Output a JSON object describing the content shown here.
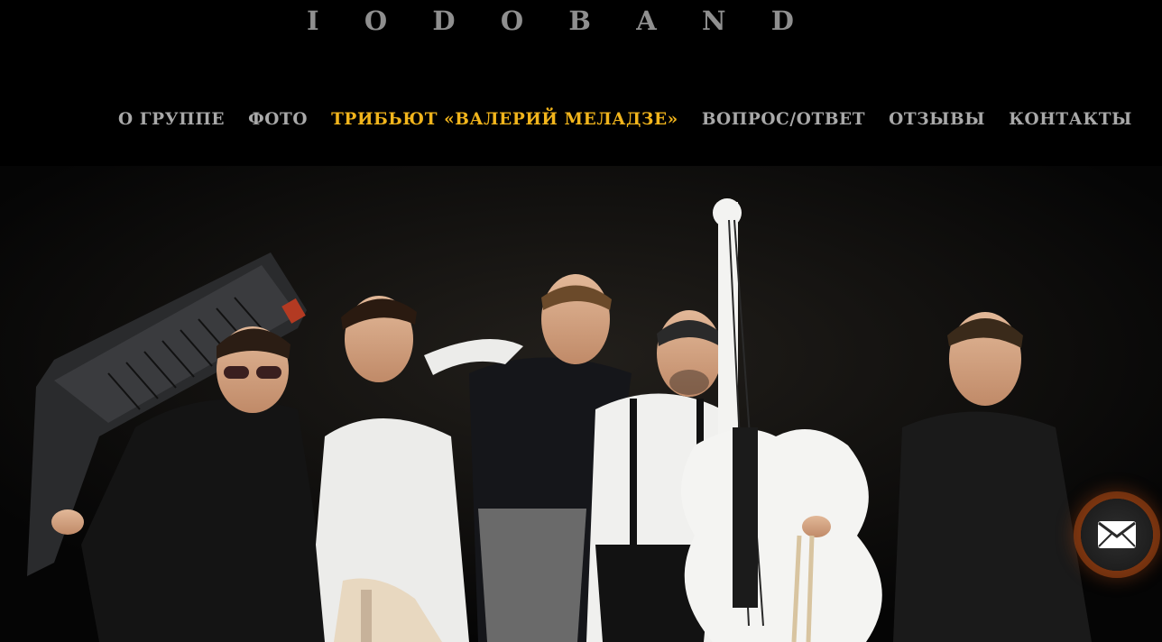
{
  "brand": {
    "letters": [
      "I",
      "O",
      "D",
      "O",
      "B",
      "A",
      "N",
      "D"
    ]
  },
  "nav": {
    "items": [
      {
        "label": "О ГРУППЕ",
        "active": false
      },
      {
        "label": "ФОТО",
        "active": false
      },
      {
        "label": "ТРИБЬЮТ «ВАЛЕРИЙ МЕЛАДЗЕ»",
        "active": true
      },
      {
        "label": "ВОПРОС/ОТВЕТ",
        "active": false
      },
      {
        "label": "ОТЗЫВЫ",
        "active": false
      },
      {
        "label": "КОНТАКТЫ",
        "active": false
      }
    ]
  },
  "hero": {
    "description": "Band photo: five musicians in black and white shirts with keytar, electric guitar and white double bass against a black backdrop"
  },
  "chat_widget": {
    "icon": "envelope-icon"
  },
  "colors": {
    "background": "#000000",
    "nav_text": "#a9a9a9",
    "nav_active": "#f2b51c",
    "logo": "#8f8f8f",
    "widget_glow": "#b04a14"
  }
}
